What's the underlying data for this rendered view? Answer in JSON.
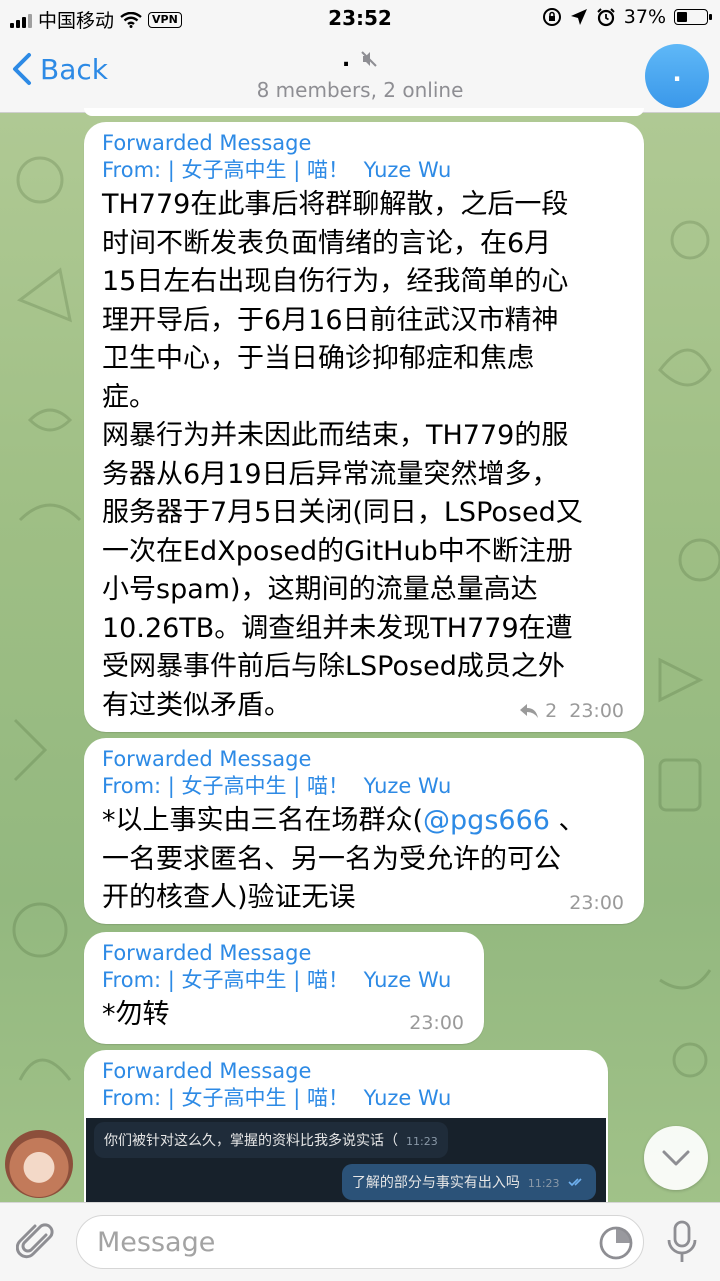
{
  "status_bar": {
    "carrier": "中国移动",
    "vpn": "VPN",
    "time": "23:52",
    "battery": "37%",
    "battery_level": 0.37
  },
  "nav": {
    "back_label": "Back",
    "title": ".",
    "subtitle": "8 members, 2 online",
    "group_avatar_text": "."
  },
  "messages": [
    {
      "forward_label": "Forwarded Message",
      "from_label": "From:",
      "from_name": "| 女子高中生 | 喵！",
      "from_author": "Yuze Wu",
      "lines": [
        "TH779在此事后将群聊解散，之后一段",
        "时间不断发表负面情绪的言论，在6月",
        "15日左右出现自伤行为，经我简单的心",
        "理开导后，于6月16日前往武汉市精神",
        "卫生中心，于当日确诊抑郁症和焦虑",
        "症。",
        "网暴行为并未因此而结束，TH779的服",
        "务器从6月19日后异常流量突然增多，",
        "服务器于7月5日关闭(同日，LSPosed又",
        "一次在EdXposed的GitHub中不断注册",
        "小号spam)，这期间的流量总量高达",
        "10.26TB。调查组并未发现TH779在遭",
        "受网暴事件前后与除LSPosed成员之外",
        "有过类似矛盾。"
      ],
      "replies": "2",
      "time": "23:00"
    },
    {
      "forward_label": "Forwarded Message",
      "from_label": "From:",
      "from_name": "| 女子高中生 | 喵！",
      "from_author": "Yuze Wu",
      "line1_prefix": "*以上事实由三名在场群众(",
      "mention": "@pgs666",
      "line1_suffix": " 、",
      "line2": "一名要求匿名、另一名为受允许的可公",
      "line3": "开的核查人)验证无误",
      "time": "23:00"
    },
    {
      "forward_label": "Forwarded Message",
      "from_label": "From:",
      "from_name": "| 女子高中生 | 喵！",
      "from_author": "Yuze Wu",
      "text": "*勿转",
      "time": "23:00"
    },
    {
      "forward_label": "Forwarded Message",
      "from_label": "From:",
      "from_name": "| 女子高中生 | 喵！",
      "from_author": "Yuze Wu",
      "image": {
        "incoming_text": "你们被针对这么久，掌握的资料比我多说实话（",
        "incoming_time": "11:23",
        "outgoing_text": "了解的部分与事实有出入吗",
        "outgoing_time": "11:23"
      }
    }
  ],
  "input": {
    "placeholder": "Message"
  }
}
